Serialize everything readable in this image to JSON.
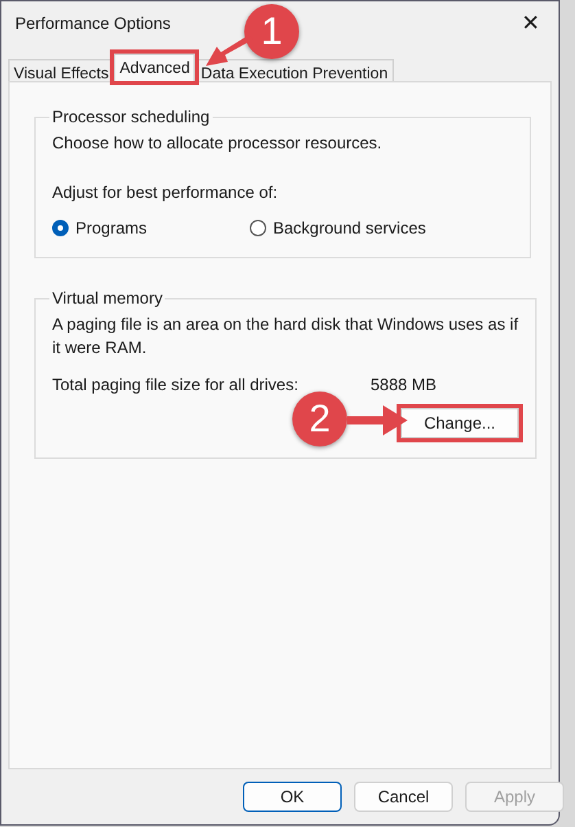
{
  "window": {
    "title": "Performance Options",
    "close": "✕"
  },
  "tabs": [
    {
      "label": "Visual Effects",
      "selected": false,
      "highlighted": false
    },
    {
      "label": "Advanced",
      "selected": true,
      "highlighted": true
    },
    {
      "label": "Data Execution Prevention",
      "selected": false,
      "highlighted": false
    }
  ],
  "processor_scheduling": {
    "title": "Processor scheduling",
    "description": "Choose how to allocate processor resources.",
    "prompt": "Adjust for best performance of:",
    "options": [
      {
        "label": "Programs",
        "selected": true
      },
      {
        "label": "Background services",
        "selected": false
      }
    ]
  },
  "virtual_memory": {
    "title": "Virtual memory",
    "description": "A paging file is an area on the hard disk that Windows uses as if it were RAM.",
    "size_label": "Total paging file size for all drives:",
    "size_value": "5888 MB",
    "button": {
      "label": "Change...",
      "highlighted": true
    }
  },
  "buttons": [
    {
      "label": "OK",
      "kind": "default",
      "disabled": false
    },
    {
      "label": "Cancel",
      "kind": "normal",
      "disabled": false
    },
    {
      "label": "Apply",
      "kind": "normal",
      "disabled": true
    }
  ],
  "annotations": [
    {
      "number": "1",
      "kind": "diagonal"
    },
    {
      "number": "2",
      "kind": "horizontal"
    }
  ]
}
